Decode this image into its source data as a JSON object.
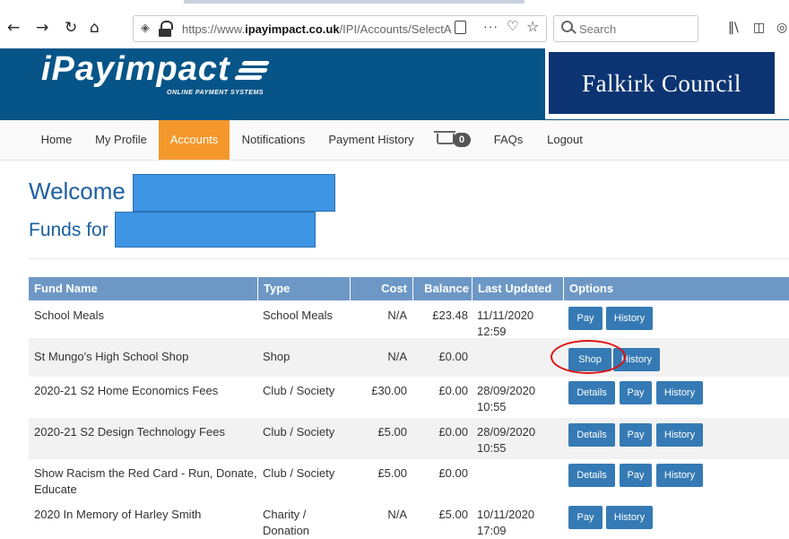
{
  "browser": {
    "url_prefix": "https://www.",
    "url_domain": "ipayimpact.co.uk",
    "url_path": "/IPI/Accounts/SelectA",
    "search_placeholder": "Search",
    "menu_dots": "···"
  },
  "banner": {
    "logo_text": "iPayimpact",
    "logo_tagline": "ONLINE PAYMENT SYSTEMS",
    "council_name": "Falkirk Council"
  },
  "nav": {
    "items": [
      "Home",
      "My Profile",
      "Accounts",
      "Notifications",
      "Payment History",
      "FAQs",
      "Logout"
    ],
    "active": "Accounts",
    "basket_count": "0"
  },
  "welcome": {
    "greeting": "Welcome",
    "funds_for": "Funds for"
  },
  "table": {
    "headers": [
      "Fund Name",
      "Type",
      "Cost",
      "Balance",
      "Last Updated",
      "Options"
    ],
    "rows": [
      {
        "name": "School Meals",
        "name2": "",
        "type": "School Meals",
        "type2": "",
        "cost": "N/A",
        "balance": "£23.48",
        "date": "11/11/2020",
        "time": "12:59",
        "buttons": [
          "Pay",
          "History"
        ]
      },
      {
        "name": "St Mungo's High School Shop",
        "name2": "",
        "type": "Shop",
        "type2": "",
        "cost": "N/A",
        "balance": "£0.00",
        "date": "",
        "time": "",
        "buttons": [
          "Shop",
          "History"
        ]
      },
      {
        "name": "2020-21 S2 Home Economics Fees",
        "name2": "",
        "type": "Club / Society",
        "type2": "",
        "cost": "£30.00",
        "balance": "£0.00",
        "date": "28/09/2020",
        "time": "10:55",
        "buttons": [
          "Details",
          "Pay",
          "History"
        ]
      },
      {
        "name": "2020-21 S2 Design Technology Fees",
        "name2": "",
        "type": "Club / Society",
        "type2": "",
        "cost": "£5.00",
        "balance": "£0.00",
        "date": "28/09/2020",
        "time": "10:55",
        "buttons": [
          "Details",
          "Pay",
          "History"
        ]
      },
      {
        "name": "Show Racism the Red Card - Run, Donate,",
        "name2": "Educate",
        "type": "Club / Society",
        "type2": "",
        "cost": "£5.00",
        "balance": "£0.00",
        "date": "",
        "time": "",
        "buttons": [
          "Details",
          "Pay",
          "History"
        ]
      },
      {
        "name": "2020 In Memory of Harley Smith",
        "name2": "",
        "type": "Charity /",
        "type2": "Donation",
        "cost": "N/A",
        "balance": "£5.00",
        "date": "10/11/2020",
        "time": "17:09",
        "buttons": [
          "Pay",
          "History"
        ]
      }
    ]
  },
  "colors": {
    "banner": "#075588",
    "nav_active": "#f4982c",
    "table_header": "#6d98c6",
    "button": "#357ab4",
    "highlight_circle": "#e01010"
  }
}
